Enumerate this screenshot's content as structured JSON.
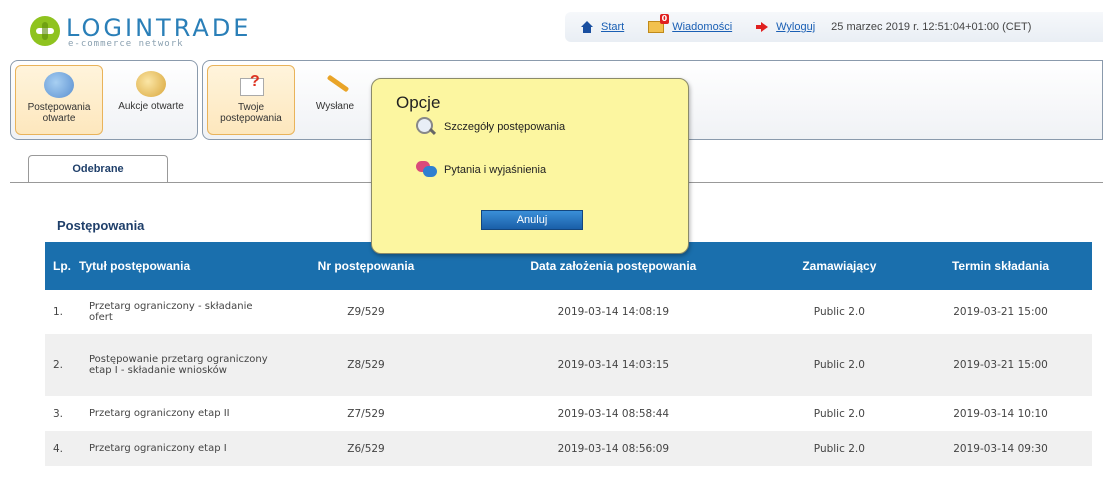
{
  "brand": {
    "name": "LOGINTRADE",
    "tagline": "e-commerce network"
  },
  "topbar": {
    "start": "Start",
    "messages": "Wiadomości",
    "messages_badge": "0",
    "logout": "Wyloguj",
    "datetime": "25 marzec 2019 r. 12:51:04+01:00 (CET)"
  },
  "toolbar": {
    "open_proceedings": "Postępowania otwarte",
    "open_auctions": "Aukcje otwarte",
    "your_proceedings": "Twoje postępowania",
    "sent": "Wysłane"
  },
  "tabs": {
    "received": "Odebrane"
  },
  "section": {
    "title": "Postępowania"
  },
  "table": {
    "headers": [
      "Lp.",
      "Tytuł postępowania",
      "Nr postępowania",
      "Data założenia postępowania",
      "Zamawiający",
      "Termin składania"
    ],
    "rows": [
      {
        "lp": "1.",
        "title": "Przetarg ograniczony - składanie ofert",
        "nr": "Z9/529",
        "date": "2019-03-14 14:08:19",
        "buyer": "Public 2.0",
        "deadline": "2019-03-21 15:00"
      },
      {
        "lp": "2.",
        "title": "Postępowanie przetarg ograniczony etap I - składanie wniosków",
        "nr": "Z8/529",
        "date": "2019-03-14 14:03:15",
        "buyer": "Public 2.0",
        "deadline": "2019-03-21 15:00"
      },
      {
        "lp": "3.",
        "title": "Przetarg ograniczony etap II",
        "nr": "Z7/529",
        "date": "2019-03-14 08:58:44",
        "buyer": "Public 2.0",
        "deadline": "2019-03-14 10:10"
      },
      {
        "lp": "4.",
        "title": "Przetarg ograniczony etap I",
        "nr": "Z6/529",
        "date": "2019-03-14 08:56:09",
        "buyer": "Public 2.0",
        "deadline": "2019-03-14 09:30"
      }
    ]
  },
  "popup": {
    "title": "Opcje",
    "option_details": "Szczegóły postępowania",
    "option_questions": "Pytania i wyjaśnienia",
    "cancel": "Anuluj"
  }
}
